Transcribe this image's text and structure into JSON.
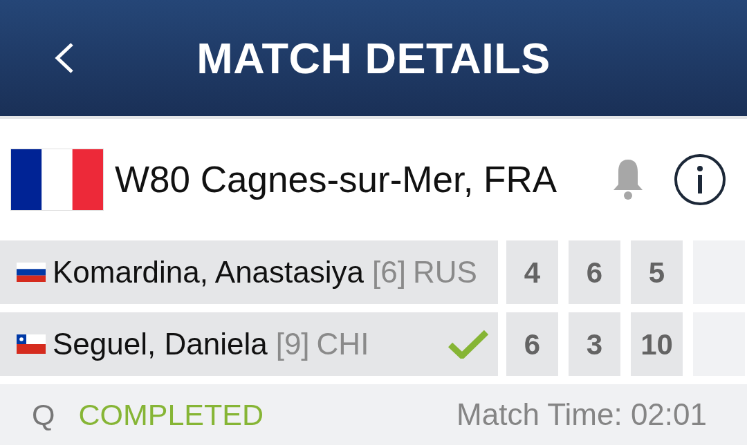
{
  "header": {
    "title": "MATCH DETAILS"
  },
  "tournament": {
    "flag": {
      "kind": "france"
    },
    "name": "W80 Cagnes-sur-Mer, FRA",
    "alerts_on": false
  },
  "players": [
    {
      "flag": {
        "kind": "russia"
      },
      "name": "Komardina, Anastasiya",
      "seed": "[6]",
      "country": "RUS",
      "winner": false,
      "scores": [
        "4",
        "6",
        "5"
      ]
    },
    {
      "flag": {
        "kind": "chile"
      },
      "name": "Seguel, Daniela",
      "seed": "[9]",
      "country": "CHI",
      "winner": true,
      "scores": [
        "6",
        "3",
        "10"
      ]
    }
  ],
  "status_bar": {
    "round": "Q",
    "status": {
      "kind": "completed",
      "label": "COMPLETED"
    },
    "match_time": "Match Time: 02:01"
  }
}
